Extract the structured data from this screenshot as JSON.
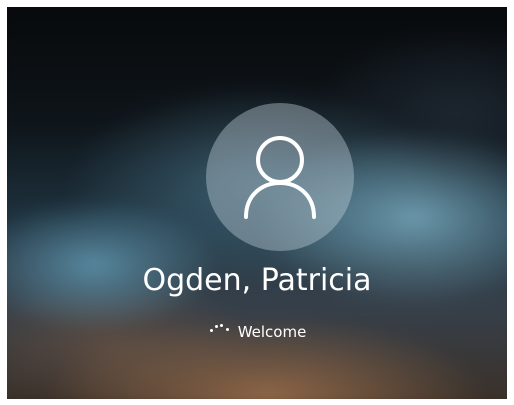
{
  "screen": {
    "type": "windows-sign-in",
    "accent_color": "#ffffff"
  },
  "user": {
    "name": "Ogden, Patricia",
    "avatar_icon": "user-silhouette-icon"
  },
  "status": {
    "text": "Welcome",
    "indicator_icon": "loading-dots-icon"
  }
}
